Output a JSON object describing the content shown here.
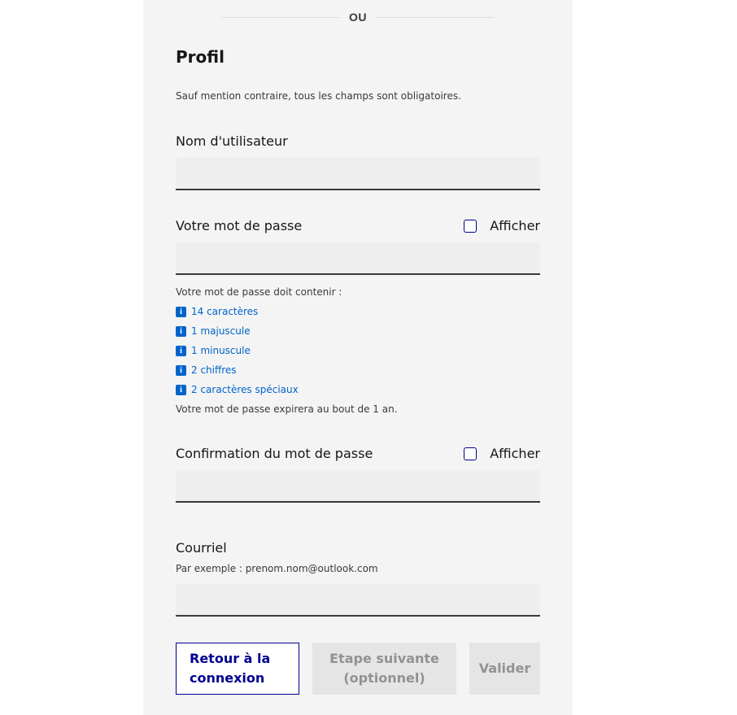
{
  "separator": {
    "text": "OU"
  },
  "form": {
    "title": "Profil",
    "required_hint": "Sauf mention contraire, tous les champs sont obligatoires.",
    "username": {
      "label": "Nom d'utilisateur",
      "value": "",
      "placeholder": ""
    },
    "password": {
      "label": "Votre mot de passe",
      "show_label": "Afficher",
      "show_checked": false,
      "value": "",
      "requirements_intro": "Votre mot de passe doit contenir :",
      "requirements": [
        "14 caractères",
        "1 majuscule",
        "1 minuscule",
        "2 chiffres",
        "2 caractères spéciaux"
      ],
      "expiry_note": "Votre mot de passe expirera au bout de 1 an."
    },
    "confirm_password": {
      "label": "Confirmation du mot de passe",
      "show_label": "Afficher",
      "show_checked": false,
      "value": ""
    },
    "email": {
      "label": "Courriel",
      "hint": "Par exemple : prenom.nom@outlook.com",
      "value": ""
    }
  },
  "buttons": {
    "back_line1": "Retour à la",
    "back_line2": "connexion",
    "next_line1": "Etape suivante",
    "next_line2": "(optionnel)",
    "validate": "Valider"
  },
  "icons": {
    "requirement": "info-icon"
  },
  "colors": {
    "panel_bg": "#f4f4f4",
    "accent": "#000091",
    "info": "#0063cb",
    "disabled_bg": "#e5e5e5",
    "disabled_text": "#929292"
  }
}
